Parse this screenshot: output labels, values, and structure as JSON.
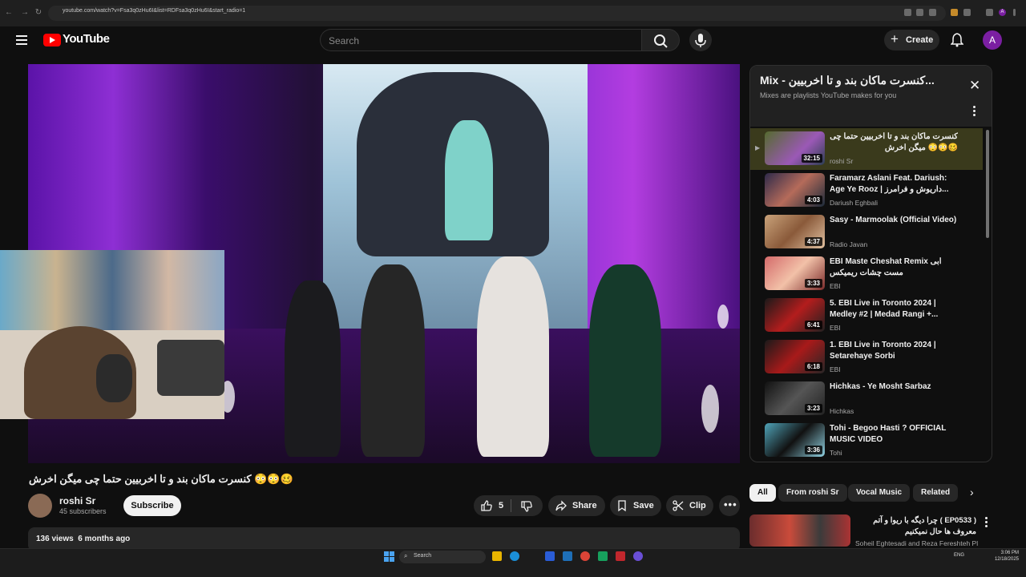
{
  "browser": {
    "url": "youtube.com/watch?v=Fsa3q0zHu6I&list=RDFsa3q0zHu6I&start_radio=1",
    "profile_initial": "A"
  },
  "header": {
    "logo_text": "YouTube",
    "search_placeholder": "Search",
    "create_label": "Create",
    "avatar_initial": "A"
  },
  "video": {
    "title": "کنسرت ماکان بند و تا اخربیین حتما چی میگن اخرش 😳😳🥴",
    "channel": "roshi Sr",
    "subscribers": "45 subscribers",
    "subscribe_label": "Subscribe",
    "likes": "5",
    "share_label": "Share",
    "save_label": "Save",
    "clip_label": "Clip",
    "views": "136 views",
    "age": "6 months ago"
  },
  "playlist": {
    "title": "Mix - کنسرت ماکان بند و تا اخربیین...",
    "subtitle": "Mixes are playlists YouTube makes for you",
    "items": [
      {
        "title": "کنسرت ماکان بند و تا اخربیین حتما چی میگن اخرش 😳😳🥴",
        "channel": "roshi Sr",
        "duration": "32:15",
        "active": true
      },
      {
        "title": "Faramarz Aslani Feat. Dariush: Age Ye Rooz | داریوش و فرامرز...",
        "channel": "Dariush Eghbali",
        "duration": "4:03"
      },
      {
        "title": "Sasy - Marmoolak (Official Video)",
        "channel": "Radio Javan",
        "duration": "4:37"
      },
      {
        "title": "EBI Maste Cheshat Remix ابی مست چشات ریمیکس",
        "channel": "EBI",
        "duration": "3:33"
      },
      {
        "title": "5. EBI Live in Toronto 2024 | Medley #2 | Medad Rangi +...",
        "channel": "EBI",
        "duration": "6:41"
      },
      {
        "title": "1. EBI Live in Toronto 2024 | Setarehaye Sorbi",
        "channel": "EBI",
        "duration": "6:18"
      },
      {
        "title": "Hichkas - Ye Mosht Sarbaz",
        "channel": "Hichkas",
        "duration": "3:23"
      },
      {
        "title": "Tohi - Begoo Hasti ? OFFICIAL MUSIC VIDEO",
        "channel": "Tohi",
        "duration": "3:36"
      }
    ]
  },
  "chips": [
    "All",
    "From roshi Sr",
    "Vocal Music",
    "Related"
  ],
  "recommendation": {
    "title": "چرا دیگه با ریوا و آتم ( EP0533 ) معروف ها حال نمیکنیم",
    "channel": "Soheil Eghtesadi and Reza Fereshteh Pl"
  },
  "taskbar": {
    "search_label": "Search",
    "lang": "ENG",
    "time": "3:06 PM",
    "date": "12/18/2025"
  },
  "colors": {
    "background": "#0f0f0f",
    "brand_red": "#ff0000",
    "avatar_purple": "#7b1fa2",
    "active_item": "#3a3a1c"
  }
}
